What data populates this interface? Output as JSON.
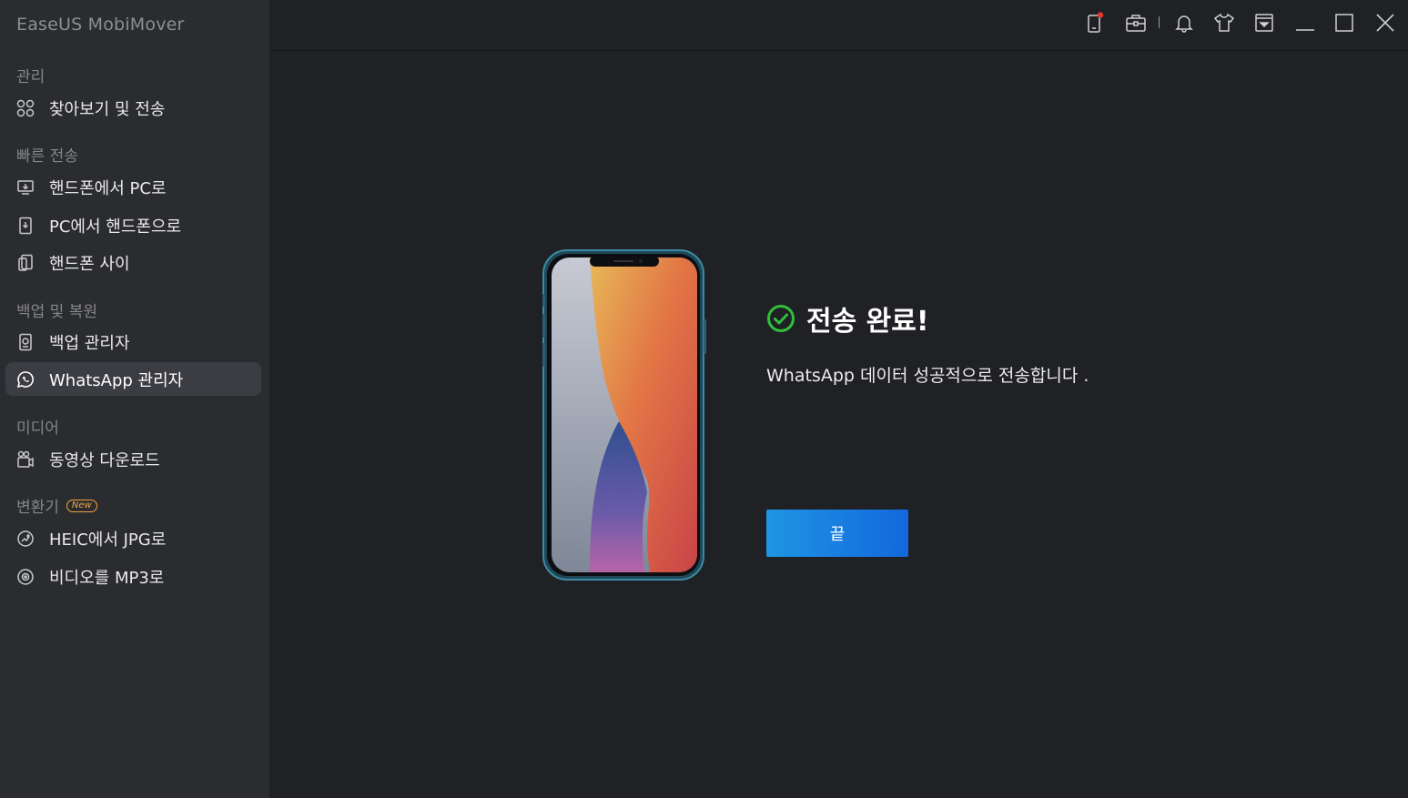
{
  "app": {
    "title": "EaseUS MobiMover"
  },
  "sidebar": {
    "sections": [
      {
        "label": "관리"
      },
      {
        "label": "빠른 전송"
      },
      {
        "label": "백업 및 복원"
      },
      {
        "label": "미디어"
      },
      {
        "label": "변환기",
        "badge": "New"
      }
    ],
    "items": [
      {
        "label": "찾아보기 및 전송",
        "icon": "grid-browse-icon"
      },
      {
        "label": "핸드폰에서 PC로",
        "icon": "phone-to-pc-icon"
      },
      {
        "label": "PC에서 핸드폰으로",
        "icon": "pc-to-phone-icon"
      },
      {
        "label": "핸드폰 사이",
        "icon": "phone-to-phone-icon"
      },
      {
        "label": "백업 관리자",
        "icon": "backup-icon"
      },
      {
        "label": "WhatsApp 관리자",
        "icon": "whatsapp-icon",
        "active": true
      },
      {
        "label": "동영상 다운로드",
        "icon": "video-download-icon"
      },
      {
        "label": "HEIC에서 JPG로",
        "icon": "image-convert-icon"
      },
      {
        "label": "비디오를 MP3로",
        "icon": "video-to-mp3-icon"
      }
    ]
  },
  "titlebar": {
    "icons": [
      "device-notification-icon",
      "toolbox-icon",
      "bell-icon",
      "shirt-icon",
      "dropdown-menu-icon",
      "minimize-icon",
      "maximize-icon",
      "close-icon"
    ]
  },
  "main": {
    "result_title": "전송 완료!",
    "result_message": "WhatsApp 데이터 성공적으로 전송합니다 .",
    "done_button": "끝"
  },
  "colors": {
    "accent": "#1e7fe0",
    "success": "#2fbf3c",
    "sidebar_bg": "#2b2c30",
    "main_bg": "#202124",
    "badge": "#f0a640",
    "notification_dot": "#e5392e"
  }
}
